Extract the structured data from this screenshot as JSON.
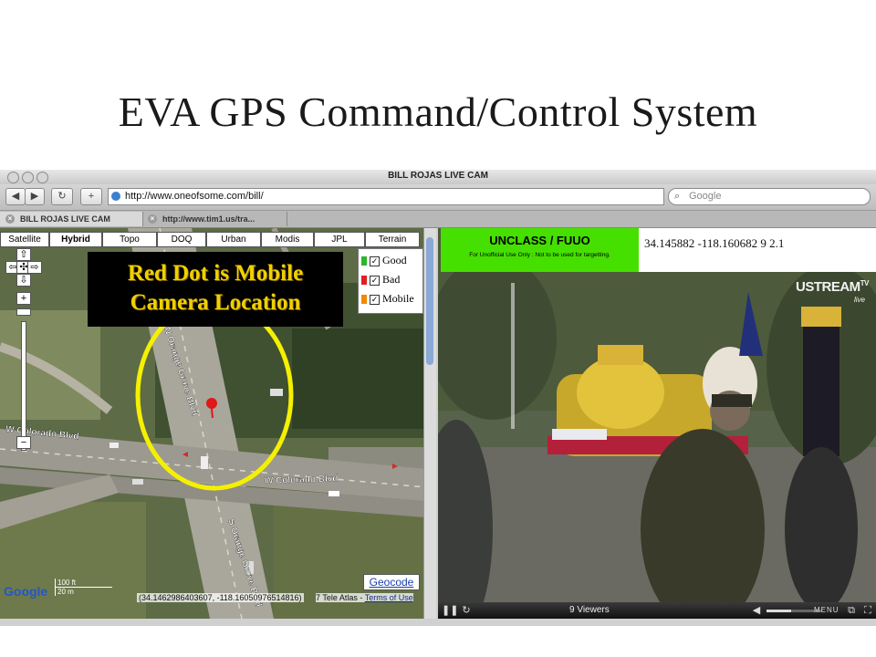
{
  "slide": {
    "title": "EVA GPS Command/Control System"
  },
  "browser": {
    "window_title": "BILL ROJAS LIVE CAM",
    "url": "http://www.oneofsome.com/bill/",
    "search_placeholder": "Google",
    "back_glyph": "◀",
    "forward_glyph": "▶",
    "reload_glyph": "↻",
    "add_glyph": "+",
    "tabs": [
      {
        "label": "BILL ROJAS LIVE CAM",
        "active": true
      },
      {
        "label": "http://www.tim1.us/tra...",
        "active": false
      }
    ]
  },
  "map": {
    "tabs": [
      "Satellite",
      "Hybrid",
      "Topo",
      "DOQ",
      "Urban",
      "Modis",
      "JPL",
      "Terrain"
    ],
    "selected_tab": "Hybrid",
    "legend": [
      {
        "label": "Good",
        "color": "#2db52d"
      },
      {
        "label": "Bad",
        "color": "#e02020"
      },
      {
        "label": "Mobile",
        "color": "#f08a00"
      }
    ],
    "callout_line1": "Red Dot is Mobile",
    "callout_line2": "Camera Location",
    "zoom_in": "+",
    "zoom_out": "−",
    "street_labels": [
      "N Orange Grove Blvd",
      "W Colorado Blvd",
      "W Colorado Blvd",
      "S Orange Grove Blvd"
    ],
    "scale_ft": "100 ft",
    "scale_m": "20 m",
    "coordinates": "(34.14629864036​07, -118.16050976514816)",
    "credit_prefix": "7 Tele Atlas - ",
    "credit_link": "Terms of Use",
    "geocode_label": "Geocode",
    "google_logo": "Google",
    "marker_color": "#e01818",
    "circle_color": "#f5f000"
  },
  "video": {
    "banner_title": "UNCLASS / FUUO",
    "banner_subtitle": "For Unofficial Use Only : Not to be used for targetting.",
    "gps_readout": "34.145882 -118.160682 9 2.1",
    "brand": "USTREAM",
    "brand_tv": "TV",
    "brand_live": "live",
    "viewers": "9 Viewers",
    "menu_label": "MENU",
    "volume_level": 0.45,
    "pause_glyph": "❚❚",
    "reload_glyph": "↻"
  }
}
